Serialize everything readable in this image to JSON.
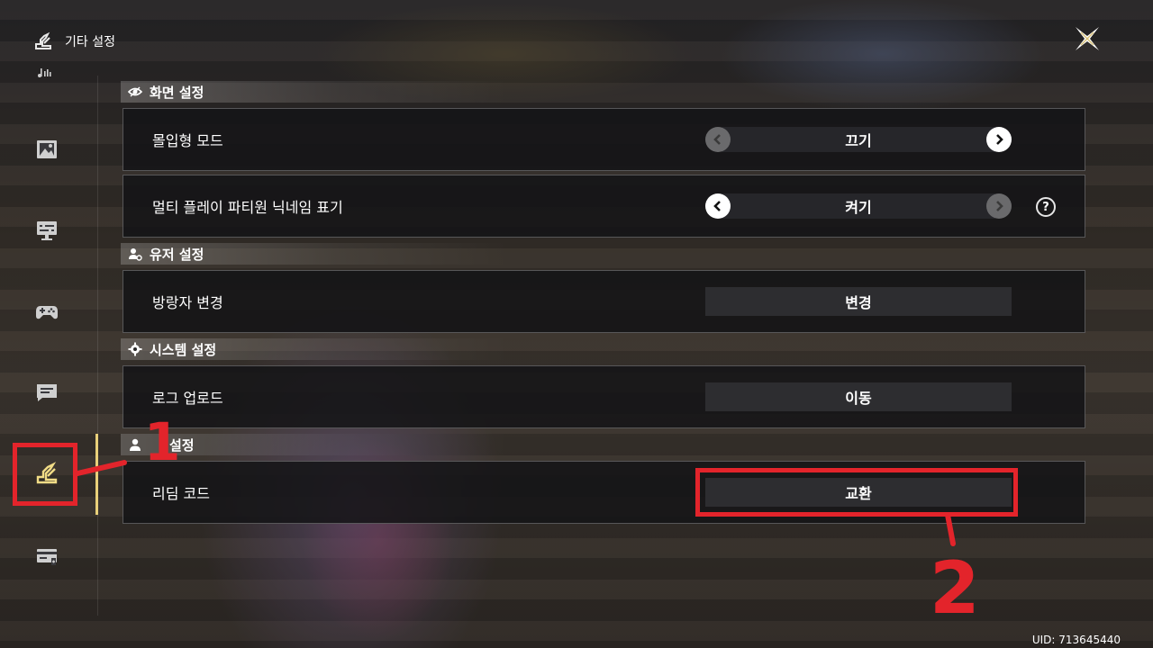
{
  "header": {
    "title": "기타 설정",
    "icon": "settings-wrench-icon"
  },
  "close": {
    "icon": "close-x-icon"
  },
  "sidebar": {
    "items": [
      {
        "id": "audio",
        "icon": "music-note-icon",
        "active": false
      },
      {
        "id": "graphics",
        "icon": "picture-icon",
        "active": false
      },
      {
        "id": "display",
        "icon": "monitor-settings-icon",
        "active": false
      },
      {
        "id": "controls",
        "icon": "gamepad-icon",
        "active": false
      },
      {
        "id": "chat",
        "icon": "chat-bubble-icon",
        "active": false
      },
      {
        "id": "other",
        "icon": "settings-wrench-icon",
        "active": true
      },
      {
        "id": "account",
        "icon": "card-icon",
        "active": false
      }
    ]
  },
  "sections": {
    "display": {
      "title": "화면 설정",
      "icon": "eye-icon"
    },
    "user": {
      "title": "유저 설정",
      "icon": "user-gear-icon"
    },
    "system": {
      "title": "시스템 설정",
      "icon": "gear-icon"
    },
    "other": {
      "title": "설정",
      "icon": "person-icon"
    }
  },
  "rows": {
    "immersive": {
      "label": "몰입형 모드",
      "value": "끄기"
    },
    "multiplayer_names": {
      "label": "멀티 플레이 파티원 닉네임 표기",
      "value": "켜기",
      "help": "?"
    },
    "wanderer": {
      "label": "방랑자 변경",
      "button": "변경"
    },
    "log_upload": {
      "label": "로그 업로드",
      "button": "이동"
    },
    "redeem": {
      "label": "리딤 코드",
      "button": "교환"
    }
  },
  "uid": "UID: 713645440",
  "annotations": {
    "step1": "1",
    "step2": "2",
    "color": "#e3242b"
  },
  "colors": {
    "accent": "#e9d07a",
    "annotation": "#e3242b"
  }
}
